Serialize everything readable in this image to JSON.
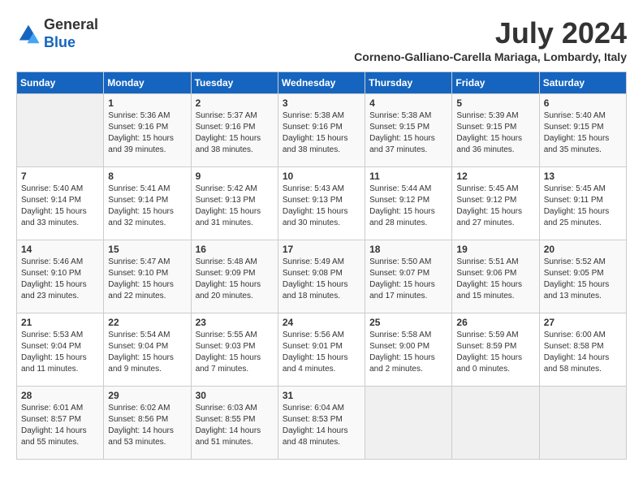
{
  "header": {
    "logo_line1": "General",
    "logo_line2": "Blue",
    "month_year": "July 2024",
    "location": "Corneno-Galliano-Carella Mariaga, Lombardy, Italy"
  },
  "days_of_week": [
    "Sunday",
    "Monday",
    "Tuesday",
    "Wednesday",
    "Thursday",
    "Friday",
    "Saturday"
  ],
  "weeks": [
    [
      {
        "day": "",
        "info": ""
      },
      {
        "day": "1",
        "info": "Sunrise: 5:36 AM\nSunset: 9:16 PM\nDaylight: 15 hours\nand 39 minutes."
      },
      {
        "day": "2",
        "info": "Sunrise: 5:37 AM\nSunset: 9:16 PM\nDaylight: 15 hours\nand 38 minutes."
      },
      {
        "day": "3",
        "info": "Sunrise: 5:38 AM\nSunset: 9:16 PM\nDaylight: 15 hours\nand 38 minutes."
      },
      {
        "day": "4",
        "info": "Sunrise: 5:38 AM\nSunset: 9:15 PM\nDaylight: 15 hours\nand 37 minutes."
      },
      {
        "day": "5",
        "info": "Sunrise: 5:39 AM\nSunset: 9:15 PM\nDaylight: 15 hours\nand 36 minutes."
      },
      {
        "day": "6",
        "info": "Sunrise: 5:40 AM\nSunset: 9:15 PM\nDaylight: 15 hours\nand 35 minutes."
      }
    ],
    [
      {
        "day": "7",
        "info": "Sunrise: 5:40 AM\nSunset: 9:14 PM\nDaylight: 15 hours\nand 33 minutes."
      },
      {
        "day": "8",
        "info": "Sunrise: 5:41 AM\nSunset: 9:14 PM\nDaylight: 15 hours\nand 32 minutes."
      },
      {
        "day": "9",
        "info": "Sunrise: 5:42 AM\nSunset: 9:13 PM\nDaylight: 15 hours\nand 31 minutes."
      },
      {
        "day": "10",
        "info": "Sunrise: 5:43 AM\nSunset: 9:13 PM\nDaylight: 15 hours\nand 30 minutes."
      },
      {
        "day": "11",
        "info": "Sunrise: 5:44 AM\nSunset: 9:12 PM\nDaylight: 15 hours\nand 28 minutes."
      },
      {
        "day": "12",
        "info": "Sunrise: 5:45 AM\nSunset: 9:12 PM\nDaylight: 15 hours\nand 27 minutes."
      },
      {
        "day": "13",
        "info": "Sunrise: 5:45 AM\nSunset: 9:11 PM\nDaylight: 15 hours\nand 25 minutes."
      }
    ],
    [
      {
        "day": "14",
        "info": "Sunrise: 5:46 AM\nSunset: 9:10 PM\nDaylight: 15 hours\nand 23 minutes."
      },
      {
        "day": "15",
        "info": "Sunrise: 5:47 AM\nSunset: 9:10 PM\nDaylight: 15 hours\nand 22 minutes."
      },
      {
        "day": "16",
        "info": "Sunrise: 5:48 AM\nSunset: 9:09 PM\nDaylight: 15 hours\nand 20 minutes."
      },
      {
        "day": "17",
        "info": "Sunrise: 5:49 AM\nSunset: 9:08 PM\nDaylight: 15 hours\nand 18 minutes."
      },
      {
        "day": "18",
        "info": "Sunrise: 5:50 AM\nSunset: 9:07 PM\nDaylight: 15 hours\nand 17 minutes."
      },
      {
        "day": "19",
        "info": "Sunrise: 5:51 AM\nSunset: 9:06 PM\nDaylight: 15 hours\nand 15 minutes."
      },
      {
        "day": "20",
        "info": "Sunrise: 5:52 AM\nSunset: 9:05 PM\nDaylight: 15 hours\nand 13 minutes."
      }
    ],
    [
      {
        "day": "21",
        "info": "Sunrise: 5:53 AM\nSunset: 9:04 PM\nDaylight: 15 hours\nand 11 minutes."
      },
      {
        "day": "22",
        "info": "Sunrise: 5:54 AM\nSunset: 9:04 PM\nDaylight: 15 hours\nand 9 minutes."
      },
      {
        "day": "23",
        "info": "Sunrise: 5:55 AM\nSunset: 9:03 PM\nDaylight: 15 hours\nand 7 minutes."
      },
      {
        "day": "24",
        "info": "Sunrise: 5:56 AM\nSunset: 9:01 PM\nDaylight: 15 hours\nand 4 minutes."
      },
      {
        "day": "25",
        "info": "Sunrise: 5:58 AM\nSunset: 9:00 PM\nDaylight: 15 hours\nand 2 minutes."
      },
      {
        "day": "26",
        "info": "Sunrise: 5:59 AM\nSunset: 8:59 PM\nDaylight: 15 hours\nand 0 minutes."
      },
      {
        "day": "27",
        "info": "Sunrise: 6:00 AM\nSunset: 8:58 PM\nDaylight: 14 hours\nand 58 minutes."
      }
    ],
    [
      {
        "day": "28",
        "info": "Sunrise: 6:01 AM\nSunset: 8:57 PM\nDaylight: 14 hours\nand 55 minutes."
      },
      {
        "day": "29",
        "info": "Sunrise: 6:02 AM\nSunset: 8:56 PM\nDaylight: 14 hours\nand 53 minutes."
      },
      {
        "day": "30",
        "info": "Sunrise: 6:03 AM\nSunset: 8:55 PM\nDaylight: 14 hours\nand 51 minutes."
      },
      {
        "day": "31",
        "info": "Sunrise: 6:04 AM\nSunset: 8:53 PM\nDaylight: 14 hours\nand 48 minutes."
      },
      {
        "day": "",
        "info": ""
      },
      {
        "day": "",
        "info": ""
      },
      {
        "day": "",
        "info": ""
      }
    ]
  ]
}
